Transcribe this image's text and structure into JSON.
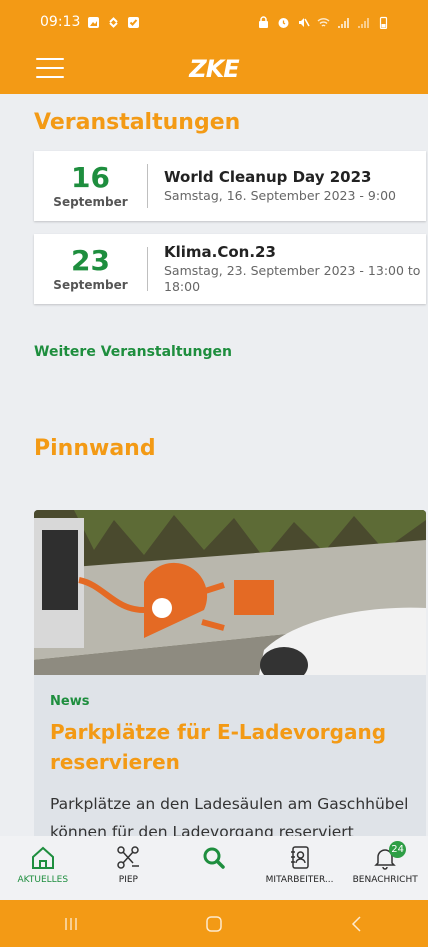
{
  "status_bar": {
    "time": "09:13"
  },
  "app_bar": {
    "logo": "ZKE"
  },
  "events_section": {
    "title": "Veranstaltungen",
    "events": [
      {
        "day": "16",
        "month": "September",
        "name": "World Cleanup Day 2023",
        "when": "Samstag, 16. September 2023 - 9:00"
      },
      {
        "day": "23",
        "month": "September",
        "name": "Klima.Con.23",
        "when": "Samstag, 23. September 2023 - 13:00 to 18:00"
      }
    ],
    "more_link": "Weitere Veranstaltungen"
  },
  "pinnwand": {
    "title": "Pinnwand",
    "card": {
      "category": "News",
      "title": "Parkplätze für E-Ladevorgang reservieren",
      "text": "Parkplätze an den Ladesäulen am Gaschhübel können für den Ladevorgang reserviert werden -"
    }
  },
  "bottom_nav": {
    "items": [
      {
        "label": "AKTUELLES",
        "icon": "home-icon",
        "active": true
      },
      {
        "label": "PIEP",
        "icon": "share-network-icon"
      },
      {
        "label": "",
        "icon": "search-icon"
      },
      {
        "label": "MITARBEITER...",
        "icon": "contacts-book-icon"
      },
      {
        "label": "BENACHRICHT",
        "icon": "bell-icon",
        "badge": "24"
      }
    ]
  },
  "colors": {
    "primary": "#f39a15",
    "accent": "#1e8e3e",
    "background": "#eceef1"
  }
}
